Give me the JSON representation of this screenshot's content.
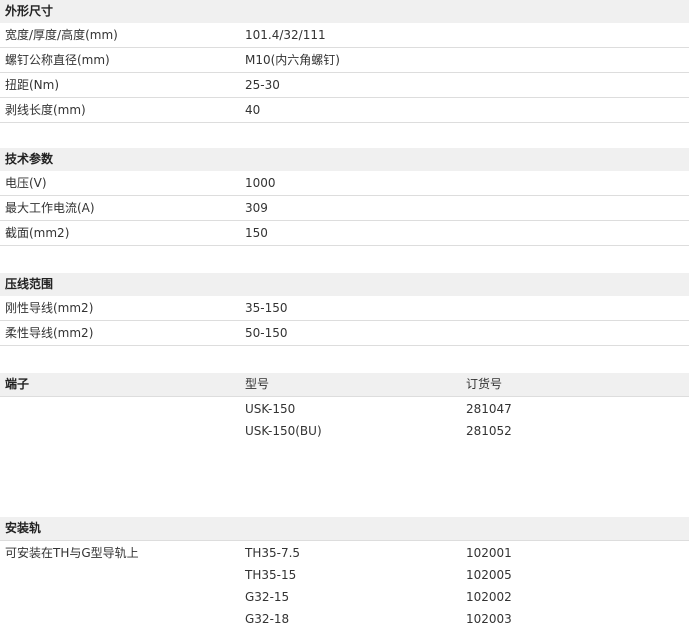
{
  "dimensions": {
    "title": "外形尺寸",
    "rows": [
      {
        "label": "宽度/厚度/高度(mm)",
        "value": "101.4/32/111"
      },
      {
        "label": "螺钉公称直径(mm)",
        "value": "M10(内六角螺钉)"
      },
      {
        "label": "扭距(Nm)",
        "value": "25-30"
      },
      {
        "label": "剥线长度(mm)",
        "value": "40"
      }
    ]
  },
  "tech": {
    "title": "技术参数",
    "rows": [
      {
        "label": "电压(V)",
        "value": "1000"
      },
      {
        "label": "最大工作电流(A)",
        "value": "309"
      },
      {
        "label": "截面(mm2)",
        "value": "150"
      }
    ]
  },
  "crimp": {
    "title": "压线范围",
    "rows": [
      {
        "label": "刚性导线(mm2)",
        "value": "35-150"
      },
      {
        "label": "柔性导线(mm2)",
        "value": "50-150"
      }
    ]
  },
  "terminal": {
    "title": "端子",
    "col_model": "型号",
    "col_order": "订货号",
    "rows": [
      {
        "model": "USK-150",
        "order": "281047"
      },
      {
        "model": "USK-150(BU)",
        "order": "281052"
      }
    ]
  },
  "rail": {
    "title": "安装轨",
    "note": "可安装在TH与G型导轨上",
    "rows": [
      {
        "model": "TH35-7.5",
        "order": "102001"
      },
      {
        "model": "TH35-15",
        "order": "102005"
      },
      {
        "model": "G32-15",
        "order": "102002"
      },
      {
        "model": "G32-18",
        "order": "102003"
      }
    ]
  }
}
